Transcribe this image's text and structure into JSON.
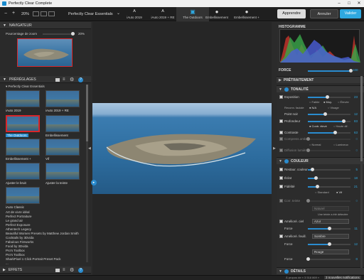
{
  "window": {
    "title": "Perfectly Clear Complete"
  },
  "toolbar": {
    "zoom": "20%",
    "preset_name": "Perfectly Clear Essentials",
    "tabs": [
      {
        "label": "iAuto 2019"
      },
      {
        "label": "iAuto 2019 + RE"
      },
      {
        "label": "The Outdoors"
      },
      {
        "label": "Embellissement"
      },
      {
        "label": "Embellissement +"
      }
    ],
    "learn": "Apprendre",
    "cancel": "Annuler",
    "validate": "Valider"
  },
  "navigator": {
    "title": "NAVIGATEUR",
    "zoom_label": "Pourcentage de zoom",
    "zoom_value": "20%"
  },
  "presets": {
    "title": "PRÉRÉGLAGES",
    "group": "Perfectly Clear Essentials",
    "thumbs": [
      {
        "label": "iAuto 2019"
      },
      {
        "label": "iAuto 2019 + RE"
      },
      {
        "label": "The Outdoors"
      },
      {
        "label": "Embellissement"
      },
      {
        "label": "Embellissement +"
      },
      {
        "label": "Vif"
      },
      {
        "label": "Ajuster le bruit"
      },
      {
        "label": "Ajuster la teinte"
      },
      {
        "label": "iAuto Classic"
      }
    ],
    "list": [
      "Art de vivre idéal",
      "Perfect Portraiture",
      "Le grand air",
      "Perfect Exposure",
      "Athentech Legacy",
      "Beautiful Women Presets by Matthew Jordan Smith",
      "Cocktails by 3Dvida",
      "Fabulous Fireworks",
      "Food by 3Dvida",
      "Pro's Toolbox",
      "Pro's Toolbox",
      "SharkPixel 1 Click Portrait Preset Pack",
      "..."
    ]
  },
  "effects": {
    "title": "EFFETS"
  },
  "histogram": {
    "title": "HISTOGRAMME"
  },
  "force": {
    "label": "FORCE",
    "value": "100"
  },
  "sections": {
    "pretreatment": "PRÉTRAITEMENT",
    "tonality": "TONALITÉ",
    "color": "COULEUR",
    "details": "DÉTAILS"
  },
  "tonality": {
    "exposure": {
      "label": "Exposition",
      "value": "23",
      "level": 0.45
    },
    "exp_modes": [
      "Faible",
      "Moy.",
      "Élevée"
    ],
    "face": {
      "label": "Reconn. faciale",
      "opts": [
        "N/A",
        "Visage"
      ]
    },
    "blackpoint": {
      "label": "Point noir",
      "value": "12",
      "level": 0.4
    },
    "depth": {
      "label": "Profondeur",
      "value": "83",
      "level": 0.83
    },
    "depth_modes": [
      "Contr. élevé",
      "Haute dif."
    ],
    "contrast": {
      "label": "Contraste",
      "value": "63",
      "level": 0.63
    },
    "curves": {
      "label": "Compress.ombr.",
      "value": "0",
      "level": 0
    },
    "curve_modes": [
      "Normal",
      "Lumineux"
    ],
    "diffusion": {
      "label": "Diffusion lumière",
      "value": "0",
      "level": 0
    }
  },
  "color": {
    "restore": {
      "label": "Restaur. couleur",
      "value": "5",
      "level": 0.1
    },
    "vibrancy": {
      "label": "Éclat",
      "value": "18",
      "level": 0.18
    },
    "fidelity": {
      "label": "Fidélité",
      "value": "21",
      "level": 0.21
    },
    "fid_modes": [
      "Standard",
      "Vif"
    ],
    "skin": {
      "label": "Corr. teinte",
      "value": "0",
      "level": 0
    },
    "skin_mode": "Naturel",
    "skin_note": "Une teinte a été détectée",
    "enh1": {
      "label": "Amélioré. ciel",
      "select": "Azur"
    },
    "force1": {
      "label": "Force",
      "value": "11",
      "level": 0.5
    },
    "enh2": {
      "label": "Amélioré. feuill.",
      "select": "Sombre"
    },
    "force2": {
      "label": "Force",
      "value": "12",
      "level": 0.5
    },
    "enh3": {
      "select": "Rouge"
    },
    "force3": {
      "label": "Force",
      "value": "0",
      "level": 0
    }
  },
  "status": {
    "left_info": "À propos de « 3 518 869 »",
    "notifications": "3 nouvelles notifications"
  },
  "colors": {
    "accent": "#2a8ccf",
    "selected_border": "#d9262b"
  }
}
